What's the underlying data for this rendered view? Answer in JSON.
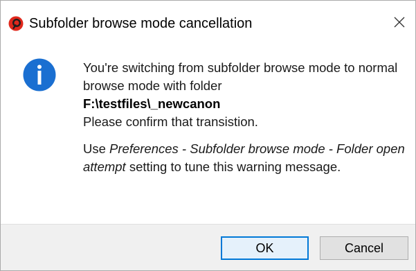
{
  "window": {
    "title": "Subfolder browse mode cancellation",
    "app_icon": "app-logo-icon",
    "close_icon": "close-icon"
  },
  "message": {
    "icon": "info-icon",
    "line1": "You're switching from subfolder browse mode to normal browse mode with folder",
    "folder": "F:\\testfiles\\_newcanon",
    "line3": "Please confirm that transistion.",
    "p2_prefix": "Use ",
    "p2_em1": "Preferences - Subfolder browse mode - Folder open attempt",
    "p2_suffix": " setting to tune this warning message."
  },
  "buttons": {
    "ok_label": "OK",
    "cancel_label": "Cancel"
  },
  "colors": {
    "accent": "#0078d7",
    "info_icon": "#1a6fd1",
    "app_icon_red": "#e0281c",
    "footer_bg": "#f0f0f0"
  }
}
